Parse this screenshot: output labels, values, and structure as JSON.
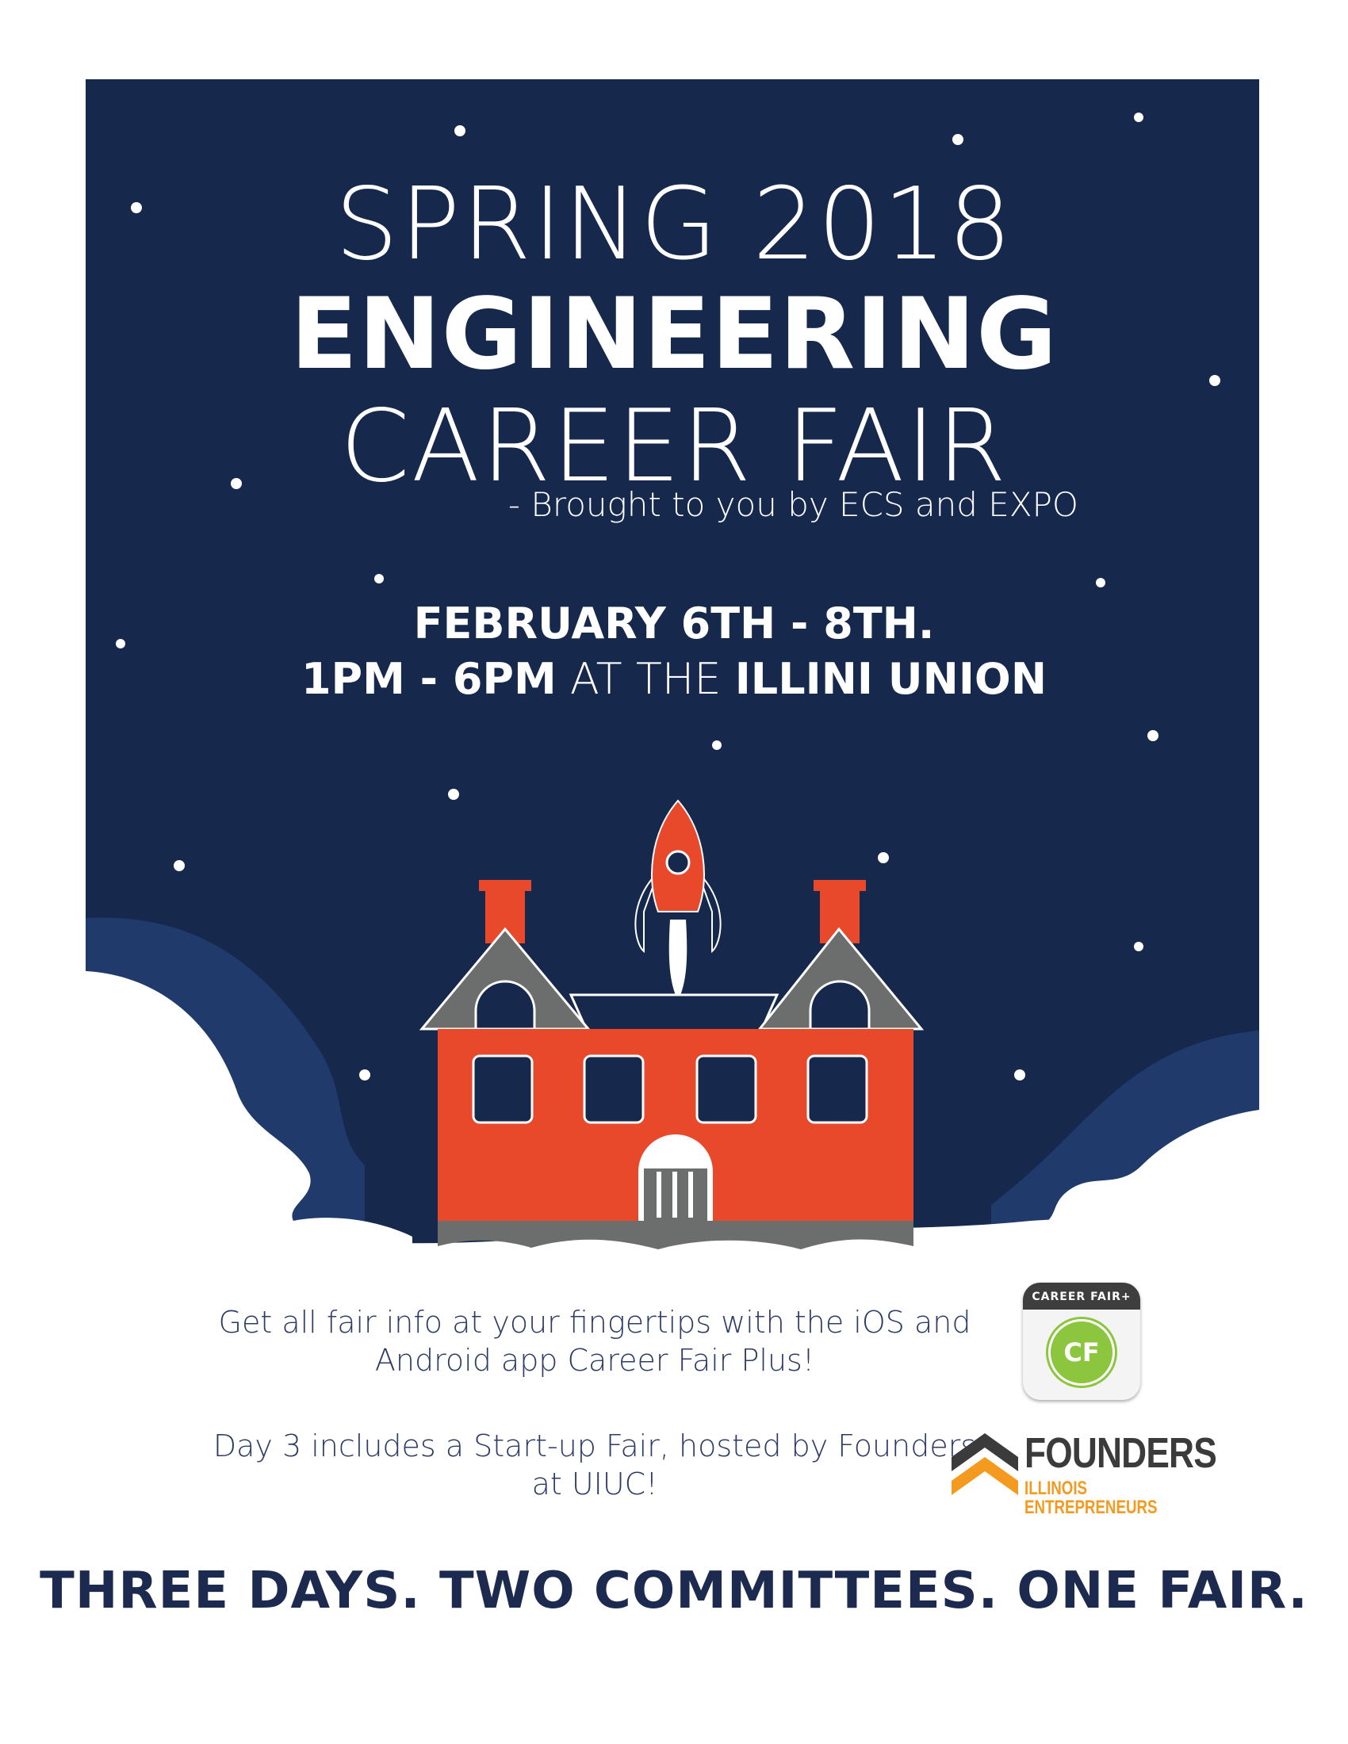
{
  "headline": {
    "line1": "SPRING 2018",
    "line2": "ENGINEERING",
    "line3": "CAREER FAIR",
    "byline": "- Brought to you by ECS and EXPO"
  },
  "event": {
    "dates": "FEBRUARY 6TH - 8TH.",
    "time": "1PM - 6PM",
    "at": " AT THE ",
    "venue": "ILLINI UNION"
  },
  "info": {
    "app_text": "Get all fair info at your fingertips with the iOS and Android app Career Fair Plus!",
    "startup_text": "Day 3 includes a Start-up Fair, hosted by Founders at UIUC!"
  },
  "app_icon": {
    "name": "CAREER FAIR+",
    "initials": "CF",
    "icon": "career-fair-plus-app-icon"
  },
  "founders_logo": {
    "name": "FOUNDERS",
    "subtitle": "ILLINOIS ENTREPRENEURS",
    "icon": "chevron-up-logo"
  },
  "tagline": "THREE DAYS. TWO COMMITTEES. ONE FAIR.",
  "colors": {
    "night_sky": "#17284d",
    "cloud_edge": "#1f3a6b",
    "building_orange": "#e8492a",
    "roof_gray": "#6b6e6c",
    "text_navy": "#1b2a4e",
    "founders_orange": "#f39a1f"
  }
}
